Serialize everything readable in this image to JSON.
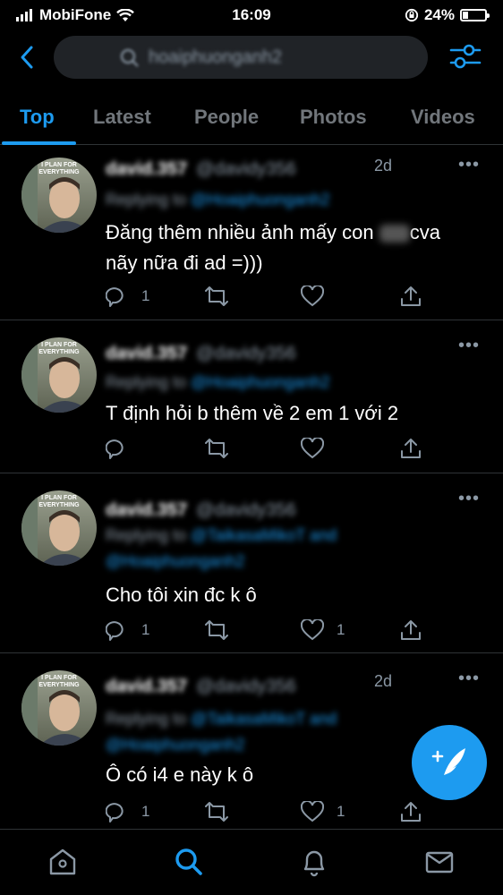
{
  "status_bar": {
    "carrier": "MobiFone",
    "time": "16:09",
    "battery_percent": "24%",
    "battery_level": 0.24
  },
  "search": {
    "query": "hoaiphuonganh2"
  },
  "tabs": [
    {
      "label": "Top",
      "active": true
    },
    {
      "label": "Latest",
      "active": false
    },
    {
      "label": "People",
      "active": false
    },
    {
      "label": "Photos",
      "active": false
    },
    {
      "label": "Videos",
      "active": false
    }
  ],
  "avatar_caption": "I PLAN FOR EVERYTHING",
  "tweets": [
    {
      "name": "david.357",
      "handle": "@davidy356",
      "time": "2d",
      "replying_prefix": "Replying to",
      "replying_handle": "@Hoaiphuonganh2",
      "replying_handle_2": "",
      "text_lines": [
        "Đăng thêm nhiều ảnh mấy con",
        "cva",
        "nãy nữa đi ad =)))"
      ],
      "reply_count": "1",
      "like_count": ""
    },
    {
      "name": "david.357",
      "handle": "@davidy356",
      "time": "",
      "replying_prefix": "Replying to",
      "replying_handle": "@Hoaiphuonganh2",
      "replying_handle_2": "",
      "text_lines": [
        "T định hỏi b thêm về 2 em 1 với 2"
      ],
      "reply_count": "",
      "like_count": ""
    },
    {
      "name": "david.357",
      "handle": "@davidy356",
      "time": "",
      "replying_prefix": "Replying to",
      "replying_handle": "@TaikasaMikoT and",
      "replying_handle_2": "@Hoaiphuonganh2",
      "text_lines": [
        "Cho tôi xin đc k ô"
      ],
      "reply_count": "1",
      "like_count": "1"
    },
    {
      "name": "david.357",
      "handle": "@davidy356",
      "time": "2d",
      "replying_prefix": "Replying to",
      "replying_handle": "@TaikasaMikoT and",
      "replying_handle_2": "@Hoaiphuonganh2",
      "text_lines": [
        "Ô có i4 e này k ô"
      ],
      "reply_count": "1",
      "like_count": "1"
    }
  ],
  "colors": {
    "accent": "#1d9bf0",
    "background": "#000000",
    "muted": "#71767b",
    "divider": "#2f3336"
  },
  "icons": [
    "back-arrow-icon",
    "search-icon",
    "filter-settings-icon",
    "reply-icon",
    "retweet-icon",
    "like-icon",
    "share-icon",
    "more-icon",
    "compose-tweet-icon",
    "home-icon",
    "notifications-bell-icon",
    "messages-mail-icon"
  ]
}
